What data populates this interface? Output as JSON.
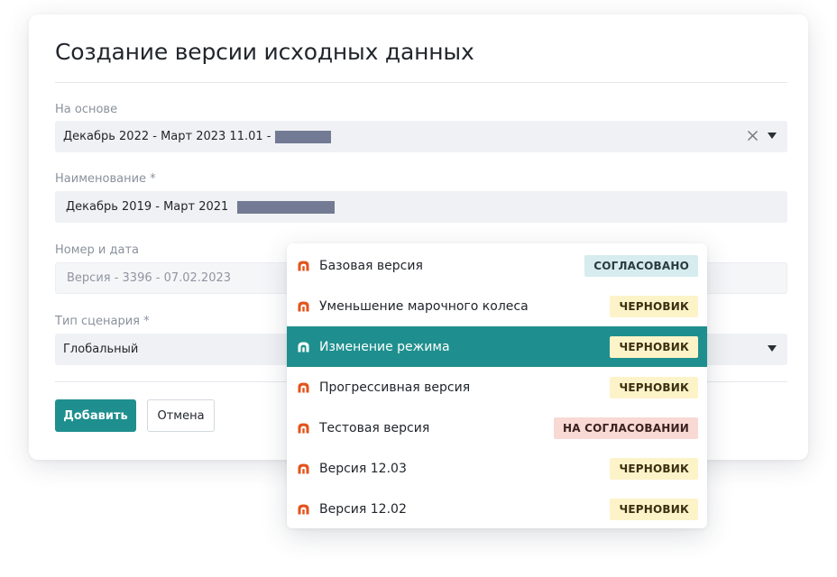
{
  "modal": {
    "title": "Создание версии исходных данных",
    "fields": {
      "basis": {
        "label": "На основе",
        "value": "Декабрь 2022 - Март 2023 11.01 -"
      },
      "name": {
        "label": "Наименование *",
        "value": "Декабрь 2019 - Март 2021"
      },
      "number_date": {
        "label": "Номер и дата",
        "value": "Версия - 3396 - 07.02.2023"
      },
      "scenario": {
        "label": "Тип сценария *",
        "value": "Глобальный"
      }
    },
    "buttons": {
      "add": "Добавить",
      "cancel": "Отмена"
    }
  },
  "dropdown": {
    "options": [
      {
        "label": "Базовая версия",
        "status": "СОГЛАСОВАНО",
        "status_kind": "approved",
        "selected": false
      },
      {
        "label": "Уменьшение марочного колеса",
        "status": "ЧЕРНОВИК",
        "status_kind": "draft",
        "selected": false
      },
      {
        "label": "Изменение режима",
        "status": "ЧЕРНОВИК",
        "status_kind": "draft",
        "selected": true
      },
      {
        "label": "Прогрессивная версия",
        "status": "ЧЕРНОВИК",
        "status_kind": "draft",
        "selected": false
      },
      {
        "label": "Тестовая версия",
        "status": "НА СОГЛАСОВАНИИ",
        "status_kind": "review",
        "selected": false
      },
      {
        "label": "Версия 12.03",
        "status": "ЧЕРНОВИК",
        "status_kind": "draft",
        "selected": false
      },
      {
        "label": "Версия 12.02",
        "status": "ЧЕРНОВИК",
        "status_kind": "draft",
        "selected": false
      }
    ]
  },
  "icons": {
    "clear": "close-icon",
    "caret": "caret-down-icon",
    "option": "furnace-icon"
  },
  "colors": {
    "primary": "#1e8f8e",
    "icon_orange": "#e2541c",
    "draft_bg": "#fdf3c8",
    "approved_bg": "#d6ecee",
    "review_bg": "#f8d9d4"
  }
}
